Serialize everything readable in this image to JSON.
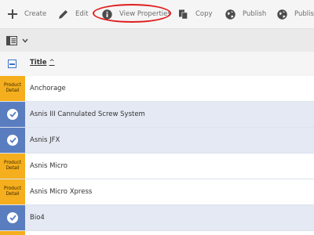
{
  "toolbar": {
    "create_label": "Create",
    "edit_label": "Edit",
    "view_properties_label": "View Properties",
    "copy_label": "Copy",
    "publish_label": "Publish",
    "publish2_label": "Publish"
  },
  "annotation": {
    "highlight_color": "#e01d1d"
  },
  "table": {
    "title_column": "Title",
    "sort_indicator": "^",
    "rows": [
      {
        "title": "Anchorage",
        "selected": false,
        "badge": [
          "Product",
          "Detail"
        ]
      },
      {
        "title": "Asnis III Cannulated Screw System",
        "selected": true
      },
      {
        "title": "Asnis JFX",
        "selected": true
      },
      {
        "title": "Asnis Micro",
        "selected": false,
        "badge": [
          "Product",
          "Detail"
        ]
      },
      {
        "title": "Asnis Micro Xpress",
        "selected": false,
        "badge": [
          "Product",
          "Detail"
        ]
      },
      {
        "title": "Bio4",
        "selected": true
      }
    ]
  },
  "colors": {
    "badge": "#f5ae1d",
    "selected_thumb": "#5a7dbf",
    "selected_row": "#e4e9f3"
  }
}
